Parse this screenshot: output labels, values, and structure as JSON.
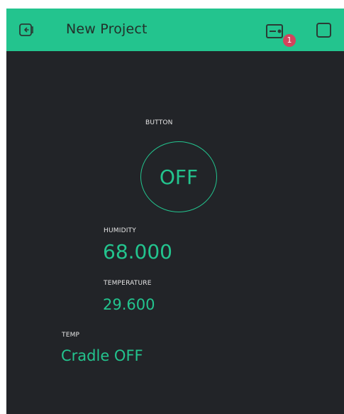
{
  "header": {
    "title": "New Project",
    "notification_count": "1",
    "icons": [
      "back-icon",
      "device-icon",
      "play-button"
    ],
    "accent_color": "#23c48e",
    "badge_color": "#d3435c"
  },
  "widgets": {
    "button": {
      "label": "BUTTON",
      "state": "OFF"
    },
    "humidity": {
      "label": "HUMIDITY",
      "value": "68.000"
    },
    "temperature": {
      "label": "TEMPERATURE",
      "value": "29.600"
    },
    "temp": {
      "label": "TEMP",
      "value": "Cradle OFF"
    }
  },
  "theme": {
    "background": "#222428",
    "text": "#e6e6e6"
  }
}
